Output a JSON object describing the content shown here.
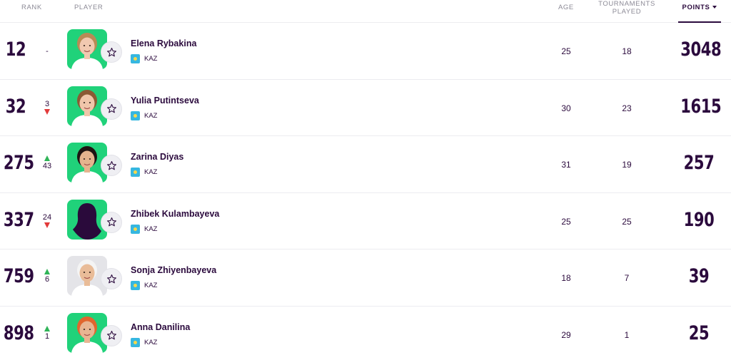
{
  "headers": {
    "rank": "RANK",
    "player": "PLAYER",
    "age": "AGE",
    "tournaments": "TOURNAMENTS PLAYED",
    "points": "POINTS"
  },
  "players": [
    {
      "rank": "12",
      "move": "-",
      "direction": "none",
      "name": "Elena Rybakina",
      "country": "KAZ",
      "age": "25",
      "tournaments": "18",
      "points": "3048",
      "photo": "green",
      "skin": "#f1c9b0",
      "hair": "#b98a55",
      "silhouette": false
    },
    {
      "rank": "32",
      "move": "3",
      "direction": "down",
      "name": "Yulia Putintseva",
      "country": "KAZ",
      "age": "30",
      "tournaments": "23",
      "points": "1615",
      "photo": "green",
      "skin": "#f0c6aa",
      "hair": "#8b5a34",
      "silhouette": false
    },
    {
      "rank": "275",
      "move": "43",
      "direction": "up",
      "name": "Zarina Diyas",
      "country": "KAZ",
      "age": "31",
      "tournaments": "19",
      "points": "257",
      "photo": "green",
      "skin": "#e4b48e",
      "hair": "#1e1412",
      "silhouette": false
    },
    {
      "rank": "337",
      "move": "24",
      "direction": "down",
      "name": "Zhibek Kulambayeva",
      "country": "KAZ",
      "age": "25",
      "tournaments": "25",
      "points": "190",
      "photo": "green",
      "skin": "#2a0a3b",
      "hair": "#2a0a3b",
      "silhouette": true
    },
    {
      "rank": "759",
      "move": "6",
      "direction": "up",
      "name": "Sonja Zhiyenbayeva",
      "country": "KAZ",
      "age": "18",
      "tournaments": "7",
      "points": "39",
      "photo": "grey",
      "skin": "#e9bc98",
      "hair": "#f4f4f4",
      "silhouette": false
    },
    {
      "rank": "898",
      "move": "1",
      "direction": "up",
      "name": "Anna Danilina",
      "country": "KAZ",
      "age": "29",
      "tournaments": "1",
      "points": "25",
      "photo": "green",
      "skin": "#e8b592",
      "hair": "#e0662e",
      "silhouette": false
    }
  ]
}
